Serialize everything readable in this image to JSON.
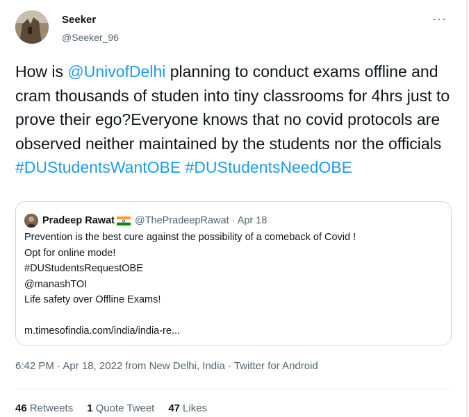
{
  "author": {
    "name": "Seeker",
    "handle": "@Seeker_96"
  },
  "more_icon": "more-horizontal-icon",
  "tweet": {
    "segments": [
      {
        "text": "How is ",
        "type": "text"
      },
      {
        "text": "@UnivofDelhi",
        "type": "mention"
      },
      {
        "text": " planning to conduct exams offline and cram thousands of studen into tiny classrooms for 4hrs just to prove their ego?Everyone knows that no covid protocols are observed neither maintained by the students nor the officials ",
        "type": "text"
      },
      {
        "text": "#DUStudentsWantOBE",
        "type": "hashtag"
      },
      {
        "text": " ",
        "type": "text"
      },
      {
        "text": "#DUStudentsNeedOBE",
        "type": "hashtag"
      }
    ]
  },
  "quote": {
    "name": "Pradeep Rawat",
    "flag": "india-flag-icon",
    "handle_date": "@ThePradeepRawat · Apr 18",
    "lines": [
      "Prevention is the best cure against the possibility of a comeback of Covid !",
      "Opt for online mode!",
      "#DUStudentsRequestOBE",
      "@manashTOI",
      "Life safety over Offline Exams!",
      "",
      "m.timesofindia.com/india/india-re..."
    ]
  },
  "meta": "6:42 PM · Apr 18, 2022 from New Delhi, India · Twitter for Android",
  "stats": {
    "retweets_count": "46",
    "retweets_label": "Retweets",
    "quotes_count": "1",
    "quotes_label": "Quote Tweet",
    "likes_count": "47",
    "likes_label": "Likes"
  },
  "colors": {
    "link": "#1d9bf0",
    "secondary": "#536471",
    "border": "#cfd9de"
  }
}
